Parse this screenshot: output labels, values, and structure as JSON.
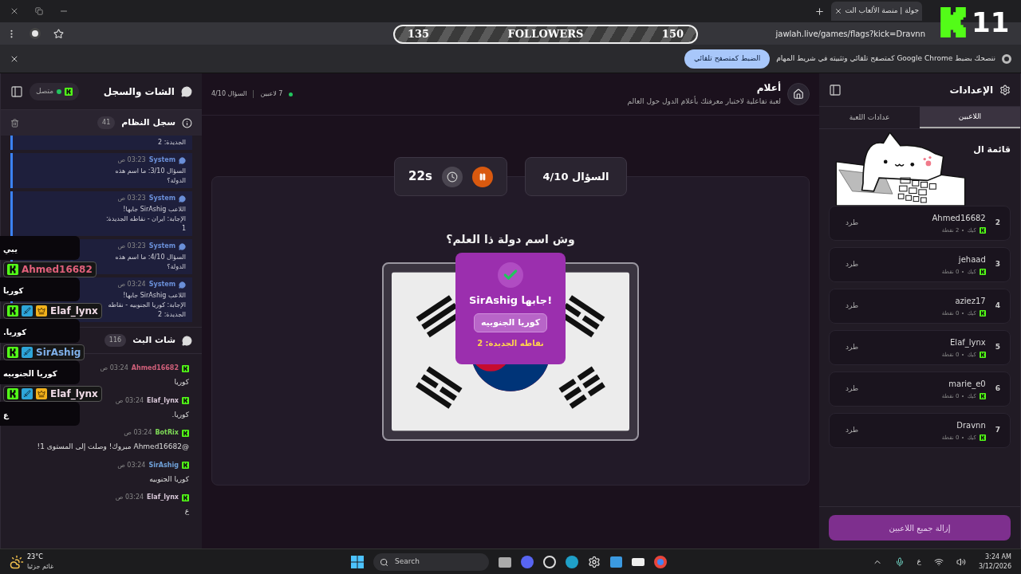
{
  "browser": {
    "tab_title": "جولة | منصة الألعاب الت",
    "address": "jawlah.live/games/flags?kick=Dravnn",
    "infobar": {
      "message": "ننصحك بضبط Google Chrome كمتصفح تلقائي وتثبيته في شريط المهام",
      "button": "الضبط كمتصفح تلقائي"
    }
  },
  "stream_overlay": {
    "followers": {
      "start": "135",
      "label": "FOLLOWERS",
      "goal": "150"
    },
    "kick_count": "11",
    "chat": [
      {
        "message": "يبي"
      },
      {
        "user": "Ahmed16682",
        "color": "#e0607a",
        "badges": [
          {
            "kind": "kick"
          }
        ],
        "message": "كوريا"
      },
      {
        "user": "Elaf_lynx",
        "color": "#f0dbe6",
        "badges": [
          {
            "kind": "kick"
          },
          {
            "kind": "mod"
          },
          {
            "kind": "vip"
          }
        ],
        "message": "كوريا."
      },
      {
        "user": "SirAshig",
        "color": "#7fb0e8",
        "badges": [
          {
            "kind": "kick"
          },
          {
            "kind": "mod"
          }
        ],
        "message": "كوريا الجنوبيه"
      },
      {
        "user": "Elaf_lynx",
        "color": "#f0dbe6",
        "badges": [
          {
            "kind": "kick"
          },
          {
            "kind": "mod"
          },
          {
            "kind": "vip"
          }
        ],
        "message": "ع"
      }
    ]
  },
  "chat_panel": {
    "title": "الشات والسجل",
    "status": "متصل",
    "connected": true,
    "log": {
      "title": "سجل النظام",
      "count": "41",
      "entries": [
        {
          "text": "الجديدة: 2"
        },
        {
          "sender": "System",
          "time": "03:23 ص",
          "text": "السؤال 3/10: ما اسم هذه الدولة؟"
        },
        {
          "sender": "System",
          "time": "03:23 ص",
          "text": "اللاعب SirAshig جابها! الإجابة: ايران - نقاطه الجديدة: 1"
        },
        {
          "sender": "System",
          "time": "03:23 ص",
          "text": "السؤال 4/10: ما اسم هذه الدولة؟"
        },
        {
          "sender": "System",
          "time": "03:24 ص",
          "text": "اللاعب SirAshig جابها! الإجابة: كوريا الجنوبيه - نقاطه الجديدة: 2"
        }
      ]
    },
    "stream": {
      "title": "شات البث",
      "count": "116",
      "messages": [
        {
          "user": "Ahmed16682",
          "color": "#d0607a",
          "time": "03:24 ص",
          "text": "كوريا"
        },
        {
          "user": "Elaf_lynx",
          "color": "#d8c8d8",
          "time": "03:24 ص",
          "text": "كوريا."
        },
        {
          "user": "BotRix",
          "color": "#7ed957",
          "time": "03:24 ص",
          "text": "@Ahmed16682 مبروك! وصلت إلى المستوى 1!"
        },
        {
          "user": "SirAshig",
          "color": "#6fa0d8",
          "time": "03:24 ص",
          "text": "كوريا الجنوبيه"
        },
        {
          "user": "Elaf_lynx",
          "color": "#d8c8d8",
          "time": "03:24 ص",
          "text": "ع"
        }
      ]
    }
  },
  "game": {
    "title": "أعلام",
    "subtitle": "لعبة تفاعلية لاختبار معرفتك بأعلام الدول حول العالم",
    "players": "7 لاعبين",
    "progress": "السؤال 4/10",
    "question_badge": "السؤال 4/10",
    "timer": "22s",
    "question": "وش اسم دولة ذا العلم؟",
    "result": {
      "title": "SirAshig جابها!",
      "answer": "كوريا الجنوبيه",
      "points": "نقاطه الجديدة: 2"
    }
  },
  "settings": {
    "title": "الإعدادات",
    "tabs": [
      {
        "label": "اللاعبين",
        "selected": true
      },
      {
        "label": "عدادات اللعبة",
        "selected": false
      }
    ],
    "list_title": "قائمة ال",
    "players": [
      {
        "rank": "2",
        "name": "Ahmed16682",
        "platform": "كيك",
        "points": "2 نقطة",
        "action": "طرد"
      },
      {
        "rank": "3",
        "name": "jehaad",
        "platform": "كيك",
        "points": "0 نقطة",
        "action": "طرد"
      },
      {
        "rank": "4",
        "name": "aziez17",
        "platform": "كيك",
        "points": "0 نقطة",
        "action": "طرد"
      },
      {
        "rank": "5",
        "name": "Elaf_lynx",
        "platform": "كيك",
        "points": "0 نقطة",
        "action": "طرد"
      },
      {
        "rank": "6",
        "name": "marie_e0",
        "platform": "كيك",
        "points": "0 نقطة",
        "action": "طرد"
      },
      {
        "rank": "7",
        "name": "Dravnn",
        "platform": "كيك",
        "points": "0 نقطة",
        "action": "طرد"
      }
    ],
    "clear_button": "إزالة جميع اللاعبين"
  },
  "taskbar": {
    "temperature": "23°C",
    "weather": "غائم جزئيا",
    "search": "Search",
    "language": "ع",
    "time": "3:24 AM",
    "date": "3/12/2026"
  }
}
